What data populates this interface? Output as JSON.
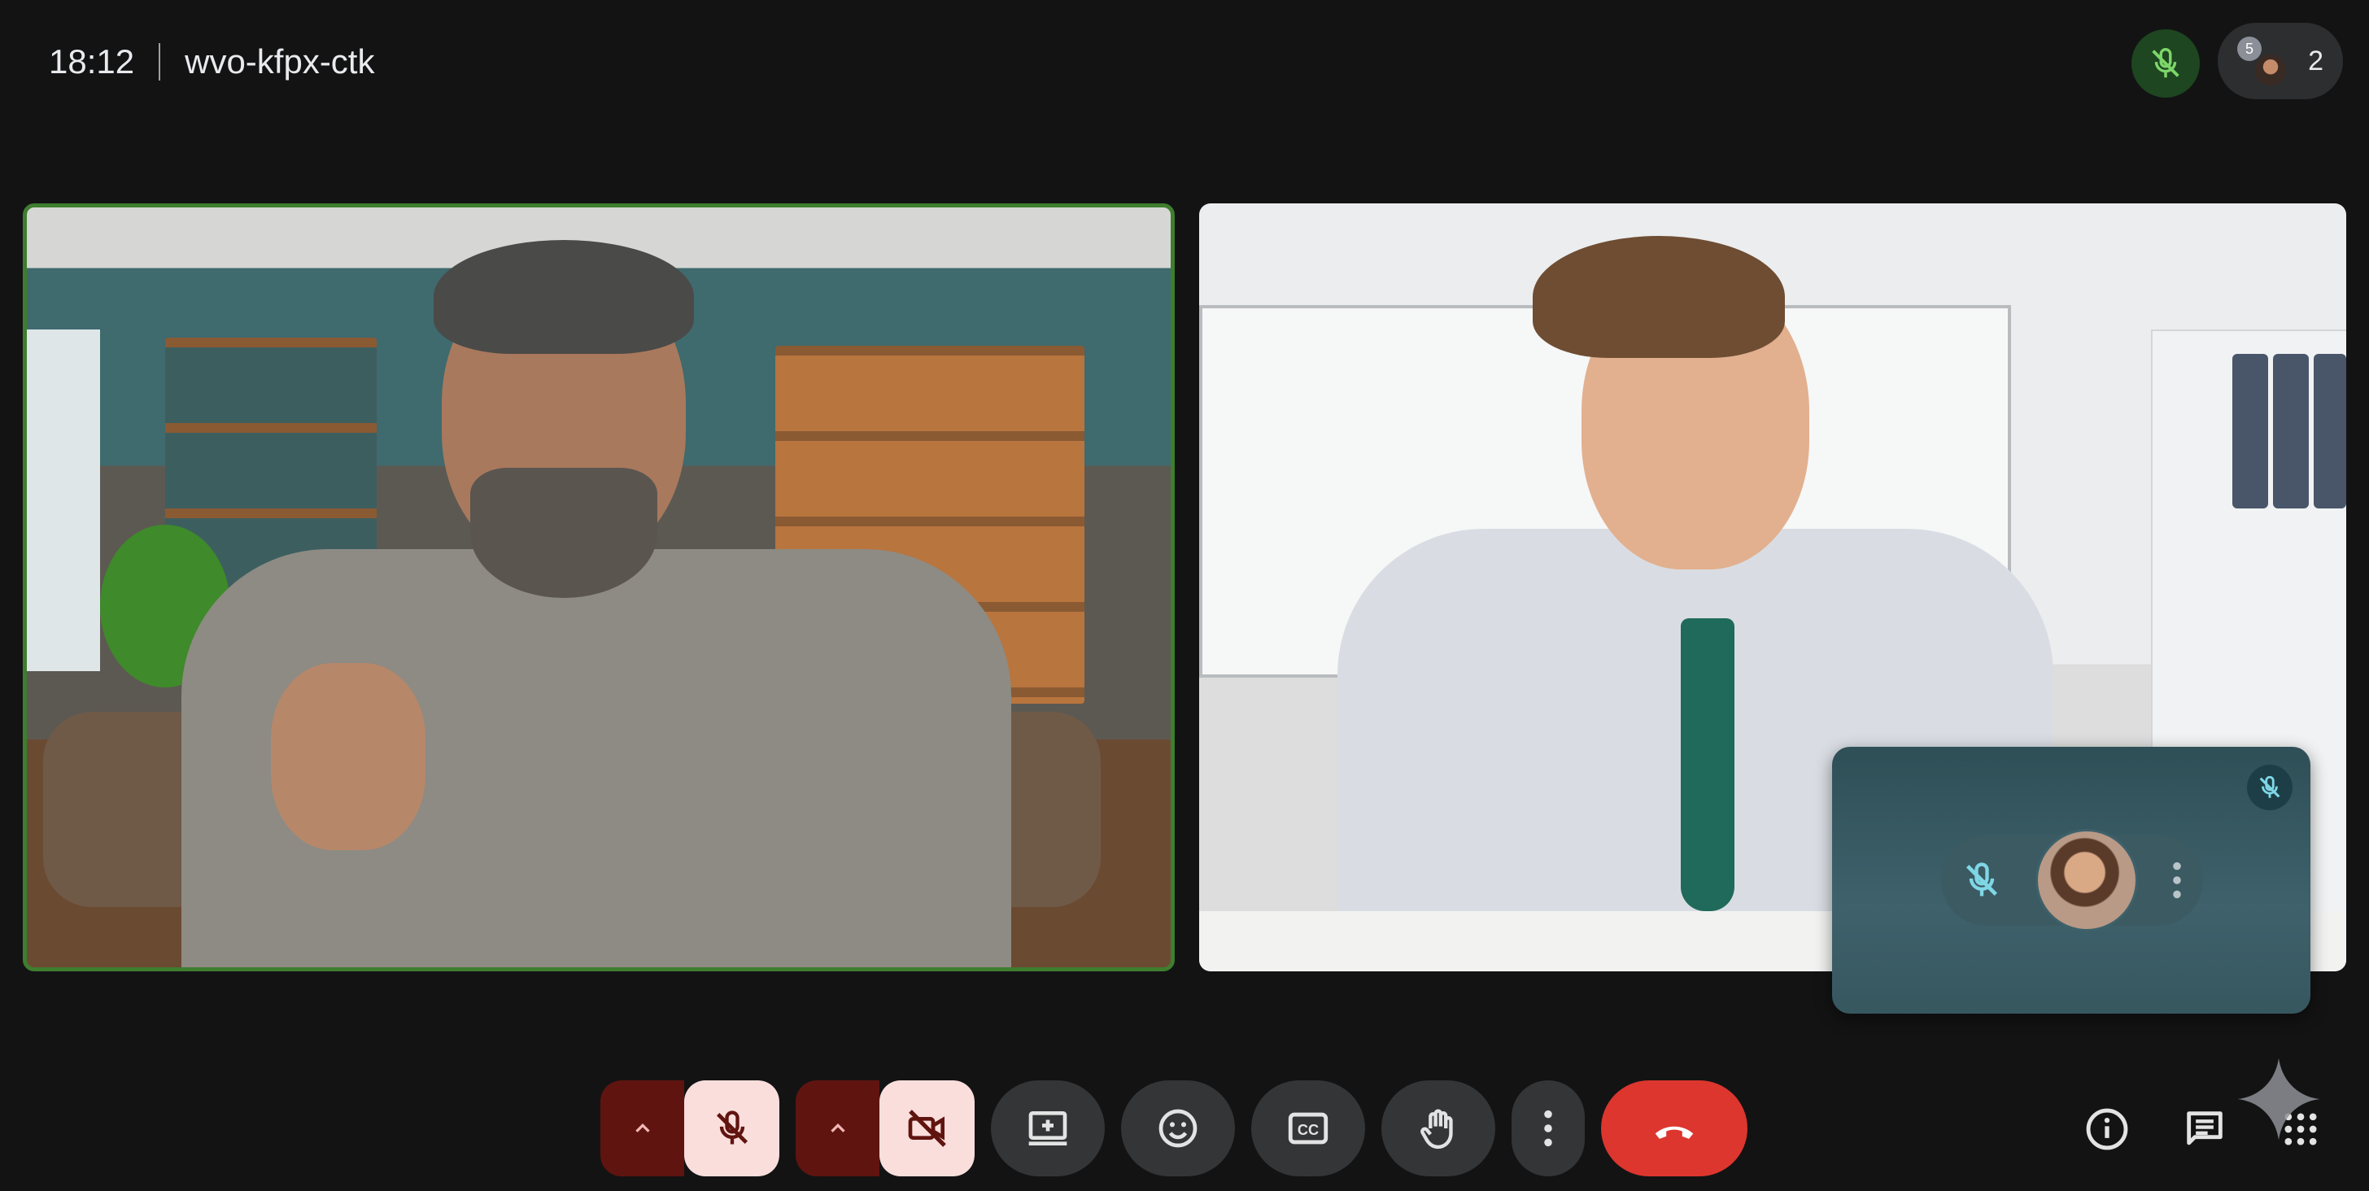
{
  "header": {
    "time": "18:12",
    "meeting_code": "wvo-kfpx-ctk"
  },
  "participants": {
    "avatar_badge": "5",
    "count": "2"
  },
  "colors": {
    "background": "#131314",
    "active_speaker_border": "#3f7d2f",
    "mic_off_accent": "#f9dedc",
    "caret_bg": "#601410",
    "end_call": "#dc362e",
    "muted_icon": "#7fd7e6"
  },
  "controls": {
    "mic": {
      "icon": "mic-off-icon",
      "state": "off"
    },
    "camera": {
      "icon": "videocam-off-icon",
      "state": "off"
    },
    "present": {
      "icon": "present-screen-icon"
    },
    "reactions": {
      "icon": "emoji-icon"
    },
    "captions": {
      "icon": "closed-captions-icon",
      "label": "CC"
    },
    "raise_hand": {
      "icon": "hand-icon"
    },
    "more": {
      "icon": "more-vert-icon"
    },
    "end_call": {
      "icon": "call-end-icon"
    }
  },
  "side_controls": [
    "info-icon",
    "chat-icon",
    "apps-grid-icon"
  ]
}
